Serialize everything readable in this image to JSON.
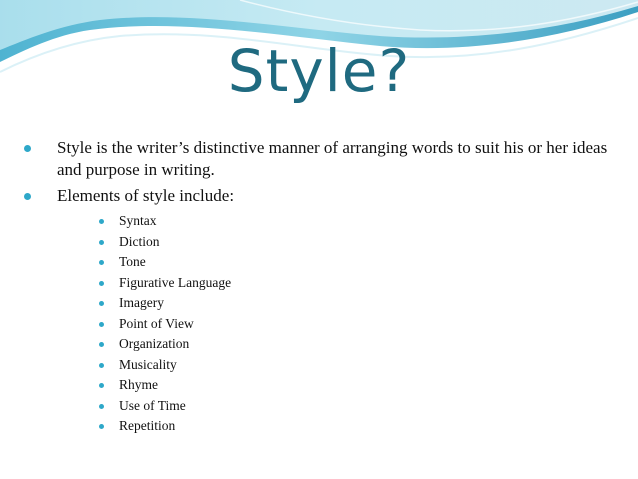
{
  "slide": {
    "title": "Style?",
    "bullets": [
      {
        "text": "Style is the writer’s distinctive manner of arranging words to suit his or her ideas and purpose in writing."
      },
      {
        "text": "Elements of style include:"
      }
    ],
    "sub_items": [
      "Syntax",
      "Diction",
      "Tone",
      "Figurative Language",
      "Imagery",
      "Point of View",
      "Organization",
      "Musicality",
      "Rhyme",
      "Use of Time",
      "Repetition"
    ]
  },
  "colors": {
    "title": "#1f6a80",
    "bullet": "#2ea8c9",
    "banner_dark": "#3fa3c4",
    "banner_light": "#c8ecf4"
  }
}
